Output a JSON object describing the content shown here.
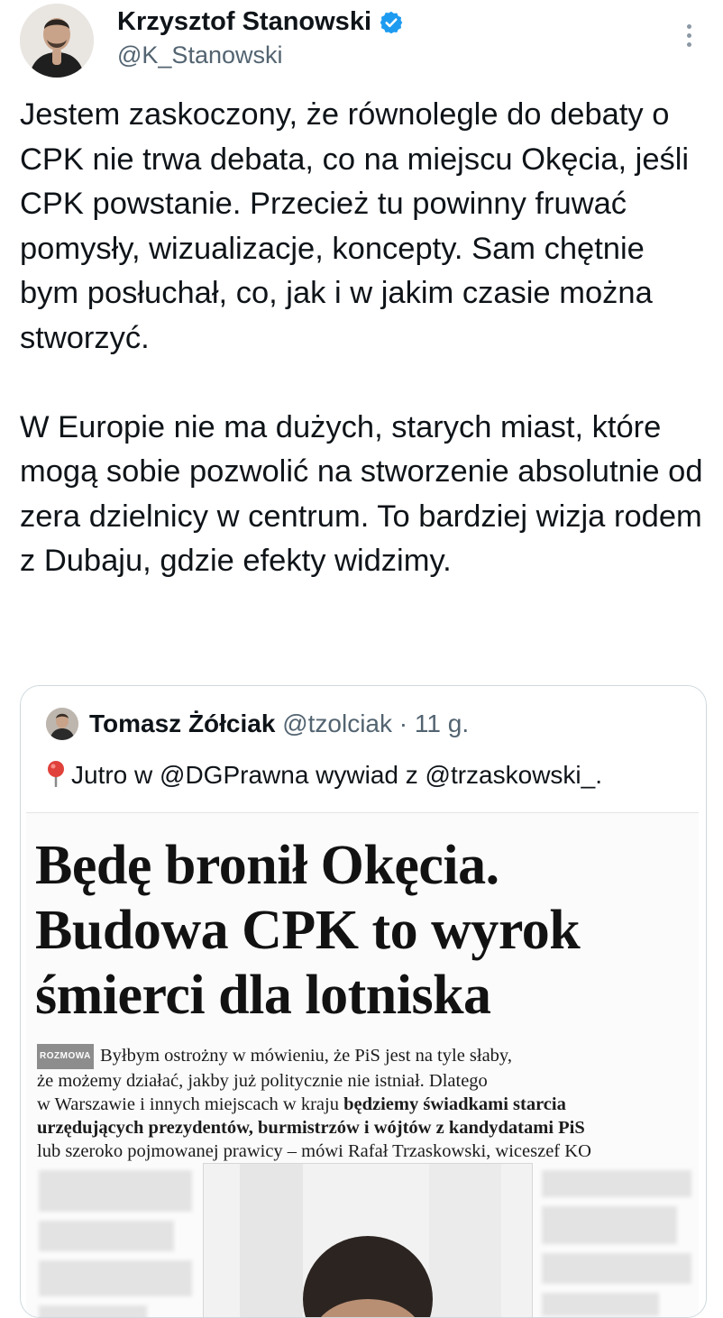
{
  "tweet": {
    "author_name": "Krzysztof Stanowski",
    "author_handle": "@K_Stanowski",
    "verified_icon": "verified-badge-icon",
    "more_icon": "more-vertical-icon",
    "paragraphs": [
      "Jestem zaskoczony, że równolegle do debaty o CPK nie trwa debata, co na miejscu Okęcia, jeśli CPK powstanie. Przecież tu powinny fruwać pomysły, wizualizacje, koncepty. Sam chętnie bym posłuchał, co, jak i w jakim czasie można stworzyć.",
      "W Europie nie ma dużych, starych miast, które mogą sobie pozwolić na stworzenie absolutnie od zera dzielnicy w centrum. To bardziej wizja rodem z Dubaju, gdzie efekty widzimy."
    ]
  },
  "quote": {
    "author_name": "Tomasz Żółciak",
    "author_handle": "@tzolciak",
    "separator": "·",
    "time": "11 g.",
    "pin_icon": "round-pushpin-icon",
    "text": "Jutro w @DGPrawna wywiad z @trzaskowski_."
  },
  "article": {
    "headline_lines": [
      "Będę bronił Okęcia.",
      "Budowa CPK to wyrok",
      "śmierci dla lotniska"
    ],
    "tag": "ROZMOWA",
    "lead_line1": "Byłbym ostrożny w mówieniu, że PiS jest na tyle słaby,",
    "lead_line2": "że możemy działać, jakby już politycznie nie istniał. Dlatego",
    "lead_line3_normal": "w Warszawie i innych miejscach w kraju ",
    "lead_line3_bold": "będziemy świadkami starcia",
    "lead_line4_bold": "urzędujących prezydentów, burmistrzów i wójtów z kandydatami PiS",
    "lead_line5": "lub szeroko pojmowanej prawicy – mówi Rafał Trzaskowski, wiceszef KO"
  }
}
